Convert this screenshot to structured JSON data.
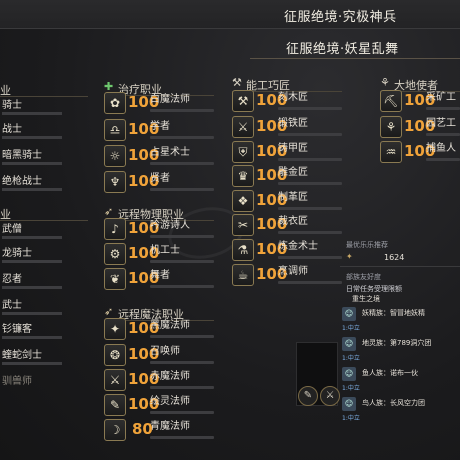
{
  "header": {
    "title": "征服绝境·究极神兵",
    "subtitle": "征服绝境·妖星乱舞"
  },
  "left_col": {
    "section1": "业",
    "jobs1": [
      "骑士",
      "战士",
      "暗黑骑士",
      "绝枪战士"
    ],
    "section2": "业",
    "jobs2": [
      "武僧",
      "龙骑士",
      "忍者",
      "武士",
      "钐镰客",
      "蝰蛇剑士",
      "驯兽师"
    ]
  },
  "healer": {
    "title": "治疗职业",
    "jobs": [
      {
        "level": "100",
        "name": "白魔法师"
      },
      {
        "level": "100",
        "name": "学者"
      },
      {
        "level": "100",
        "name": "占星术士"
      },
      {
        "level": "100",
        "name": "贤者"
      }
    ]
  },
  "ranged": {
    "title": "远程物理职业",
    "jobs": [
      {
        "level": "100",
        "name": "吟游诗人"
      },
      {
        "level": "100",
        "name": "机工士"
      },
      {
        "level": "100",
        "name": "舞者"
      }
    ]
  },
  "caster": {
    "title": "远程魔法职业",
    "jobs": [
      {
        "level": "100",
        "name": "黑魔法师"
      },
      {
        "level": "100",
        "name": "召唤师"
      },
      {
        "level": "100",
        "name": "赤魔法师"
      },
      {
        "level": "100",
        "name": "绘灵法师"
      },
      {
        "level": "80",
        "name": "青魔法师"
      }
    ]
  },
  "crafter": {
    "title": "能工巧匠",
    "jobs": [
      {
        "level": "100",
        "name": "刻木匠"
      },
      {
        "level": "100",
        "name": "锻铁匠"
      },
      {
        "level": "100",
        "name": "铸甲匠"
      },
      {
        "level": "100",
        "name": "雕金匠"
      },
      {
        "level": "100",
        "name": "制革匠"
      },
      {
        "level": "100",
        "name": "裁衣匠"
      },
      {
        "level": "100",
        "name": "炼金术士"
      },
      {
        "level": "100",
        "name": "烹调师"
      }
    ]
  },
  "gatherer": {
    "title": "大地使者",
    "jobs": [
      {
        "level": "100",
        "name": "采矿工"
      },
      {
        "level": "100",
        "name": "园艺工"
      },
      {
        "level": "100",
        "name": "捕鱼人"
      }
    ]
  },
  "panel": {
    "collect_label": "最优乐乐推荐",
    "collect_value": "1624",
    "friends_label": "部族友好度",
    "daily_label": "日常任务受理限额",
    "faction": "重生之境",
    "friends": [
      {
        "name": "妖精族：智冒地妖精",
        "status": "1:中立"
      },
      {
        "name": "地灵族：第789洞穴团",
        "status": "1:中立"
      },
      {
        "name": "鱼人族：诺布一伙",
        "status": "1:中立"
      },
      {
        "name": "鸟人族：长风空力团",
        "status": "1:中立"
      }
    ]
  },
  "colors": {
    "level_text": "#f0a33a",
    "icon_border": "#8a7a52",
    "background": "#1c1c1e"
  }
}
